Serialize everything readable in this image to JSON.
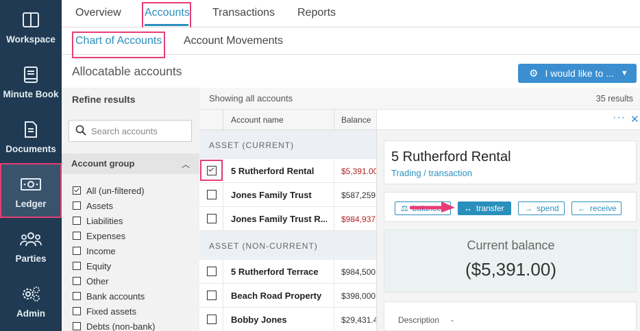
{
  "leftnav": {
    "items": [
      {
        "label": "Workspace",
        "icon": "workspace-icon"
      },
      {
        "label": "Minute Book",
        "icon": "book-icon"
      },
      {
        "label": "Documents",
        "icon": "document-icon"
      },
      {
        "label": "Ledger",
        "icon": "ledger-icon",
        "active": true
      },
      {
        "label": "Parties",
        "icon": "people-icon"
      },
      {
        "label": "Admin",
        "icon": "gears-icon"
      }
    ]
  },
  "tabs": {
    "items": [
      {
        "label": "Overview"
      },
      {
        "label": "Accounts",
        "active": true
      },
      {
        "label": "Transactions"
      },
      {
        "label": "Reports"
      }
    ]
  },
  "subtabs": {
    "items": [
      {
        "label": "Chart of Accounts",
        "active": true
      },
      {
        "label": "Account Movements"
      }
    ]
  },
  "page": {
    "title": "Allocatable accounts",
    "action_label": "I would like to ..."
  },
  "refine": {
    "title": "Refine results",
    "search_placeholder": "Search accounts",
    "group_title": "Account group",
    "filters": [
      {
        "label": "All (un-filtered)",
        "checked": true
      },
      {
        "label": "Assets",
        "checked": false
      },
      {
        "label": "Liabilities",
        "checked": false
      },
      {
        "label": "Expenses",
        "checked": false
      },
      {
        "label": "Income",
        "checked": false
      },
      {
        "label": "Equity",
        "checked": false
      },
      {
        "label": "Other",
        "checked": false
      },
      {
        "label": "Bank accounts",
        "checked": false
      },
      {
        "label": "Fixed assets",
        "checked": false
      },
      {
        "label": "Debts (non-bank)",
        "checked": false
      }
    ]
  },
  "table": {
    "showing": "Showing all accounts",
    "count": "35 results",
    "col_name": "Account name",
    "col_balance": "Balance",
    "sections": [
      {
        "label": "ASSET (CURRENT)",
        "rows": [
          {
            "name": "5 Rutherford Rental",
            "balance": "$5,391.00",
            "negative": true,
            "checked": true
          },
          {
            "name": "Jones Family Trust",
            "balance": "$587,259",
            "negative": false,
            "checked": false
          },
          {
            "name": "Jones Family Trust R...",
            "balance": "$984,937",
            "negative": true,
            "checked": false
          }
        ]
      },
      {
        "label": "ASSET (NON-CURRENT)",
        "rows": [
          {
            "name": "5 Rutherford Terrace",
            "balance": "$984,500",
            "negative": false,
            "checked": false
          },
          {
            "name": "Beach Road Property",
            "balance": "$398,000",
            "negative": false,
            "checked": false
          },
          {
            "name": "Bobby Jones",
            "balance": "$29,431.4",
            "negative": false,
            "checked": false
          }
        ]
      }
    ]
  },
  "detail": {
    "menu_glyph": "···",
    "close_glyph": "✕",
    "name": "5 Rutherford Rental",
    "subtitle": "Trading / transaction",
    "actions": [
      {
        "label": "balance",
        "glyph": "⚖"
      },
      {
        "label": "transfer",
        "glyph": "↔",
        "primary": true
      },
      {
        "label": "spend",
        "glyph": "→"
      },
      {
        "label": "receive",
        "glyph": "←"
      }
    ],
    "balance_caption": "Current balance",
    "balance_value": "($5,391.00)",
    "description_label": "Description",
    "description_value": "-"
  },
  "colors": {
    "nav_bg": "#1f3a52",
    "accent": "#2a8fbd",
    "highlight": "#e73d76",
    "negative": "#b22222"
  }
}
